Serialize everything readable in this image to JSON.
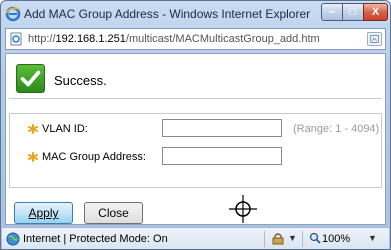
{
  "window": {
    "title": "Add MAC Group Address - Windows Internet Explorer",
    "buttons": {
      "minimize": "–",
      "maximize": "□",
      "close": "X"
    }
  },
  "address": {
    "prefix": "http://",
    "host": "192.168.1.251",
    "path": "/multicast/MACMulticastGroup_add.htm"
  },
  "message": {
    "text": "Success."
  },
  "form": {
    "vlan_label": "VLAN ID:",
    "vlan_value": "",
    "vlan_range": "(Range: 1 - 4094)",
    "mac_label": "MAC Group Address:",
    "mac_value": ""
  },
  "buttons": {
    "apply": "Apply",
    "close": "Close"
  },
  "status": {
    "zone": "Internet | Protected Mode: On",
    "zoom": "100%"
  },
  "icons": {
    "browser": "ie-logo-icon",
    "page": "page-icon",
    "success": "checkmark-icon",
    "required": "asterisk-icon",
    "cursor": "crosshair-icon",
    "zone": "globe-icon",
    "lock": "lock-icon",
    "zoom": "magnifier-icon"
  },
  "colors": {
    "required": "#e8a317",
    "success": "#3aa324",
    "range_text": "#9a9a9a"
  }
}
